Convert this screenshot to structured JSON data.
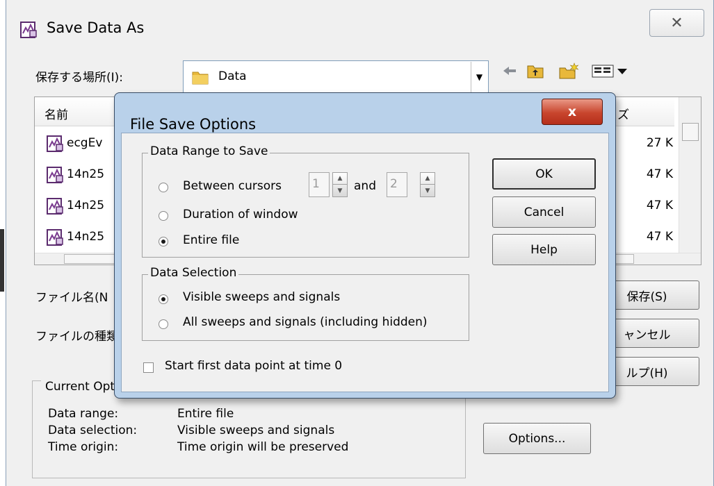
{
  "outer_window": {
    "title": "Save Data As",
    "close_glyph": "✕",
    "title_icon": "data-file-icon"
  },
  "location": {
    "label": "保存する場所(I):",
    "value": "Data",
    "toolbar_icons": [
      "back-arrow-icon",
      "up-folder-icon",
      "new-folder-icon",
      "view-menu-icon"
    ]
  },
  "file_list": {
    "columns": {
      "name": "名前",
      "size": "ズ"
    },
    "rows": [
      {
        "name": "ecgEv",
        "size": "27 K"
      },
      {
        "name": "14n25",
        "size": "47 K"
      },
      {
        "name": "14n25",
        "size": "47 K"
      },
      {
        "name": "14n25",
        "size": "47 K"
      }
    ]
  },
  "filename": {
    "label": "ファイル名(N"
  },
  "filetype": {
    "label": "ファイルの種類"
  },
  "buttons": {
    "save": "保存(S)",
    "cancel": "ャンセル",
    "help": "ルプ(H)",
    "options": "Options..."
  },
  "current_options": {
    "legend": "Current Opt",
    "rows": [
      {
        "label": "Data range:",
        "value": "Entire file"
      },
      {
        "label": "Data selection:",
        "value": "Visible sweeps and signals"
      },
      {
        "label": "Time origin:",
        "value": "Time origin will be preserved"
      }
    ]
  },
  "modal": {
    "title": "File Save Options",
    "close_glyph": "x",
    "data_range": {
      "legend": "Data Range to Save",
      "between_cursors": "Between cursors",
      "cursor_from": "1",
      "and": "and",
      "cursor_to": "2",
      "duration": "Duration of window",
      "entire": "Entire file",
      "selected": "entire"
    },
    "data_selection": {
      "legend": "Data Selection",
      "visible": "Visible sweeps and signals",
      "all": "All sweeps and signals (including hidden)",
      "selected": "visible"
    },
    "start_at_zero": {
      "label": "Start first data point at time 0",
      "checked": false
    },
    "buttons": {
      "ok": "OK",
      "cancel": "Cancel",
      "help": "Help"
    }
  },
  "colors": {
    "modal_frame": "#b9d1ea",
    "close_red": "#c8452d",
    "dialog_face": "#f0f0f0",
    "folder_yellow": "#e8b83a"
  }
}
